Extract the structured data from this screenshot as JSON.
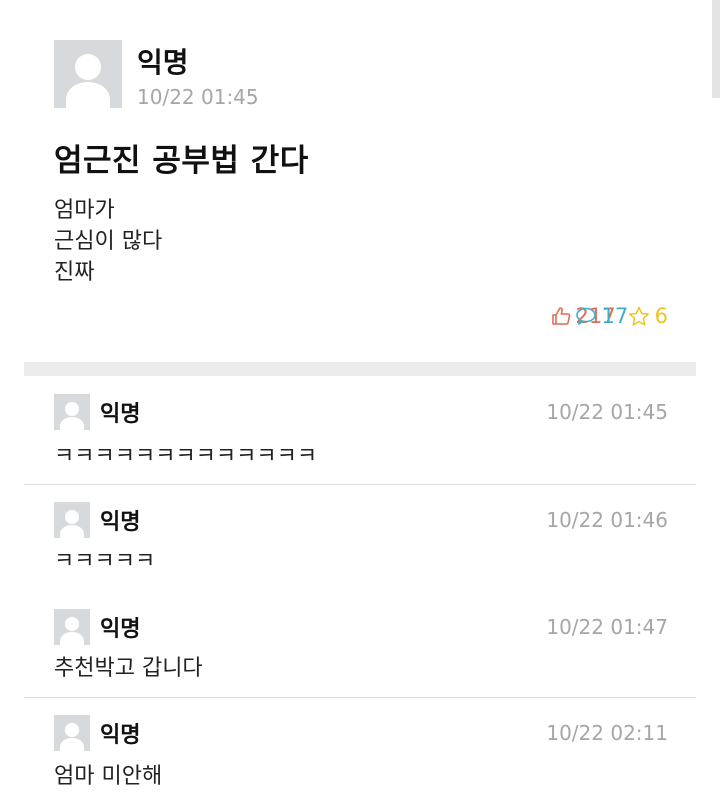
{
  "post": {
    "author": "익명",
    "time": "10/22 01:45",
    "title": "엄근진 공부법 간다",
    "body": [
      "엄마가",
      "근심이 많다",
      "진짜"
    ],
    "stats": {
      "likes": "217",
      "comments": "17",
      "scraps": "6"
    }
  },
  "comments": [
    {
      "author": "익명",
      "time": "10/22 01:45",
      "text": "ㅋㅋㅋㅋㅋㅋㅋㅋㅋㅋㅋㅋㅋ"
    },
    {
      "author": "익명",
      "time": "10/22 01:46",
      "text": "ㅋㅋㅋㅋㅋ"
    },
    {
      "author": "익명",
      "time": "10/22 01:47",
      "text": "추천박고 갑니다"
    },
    {
      "author": "익명",
      "time": "10/22 02:11",
      "text": "엄마 미안해"
    }
  ],
  "colors": {
    "like": "#e46a55",
    "comment": "#3ab0c8",
    "scrap": "#f0c419",
    "meta": "#a6a6a6"
  }
}
